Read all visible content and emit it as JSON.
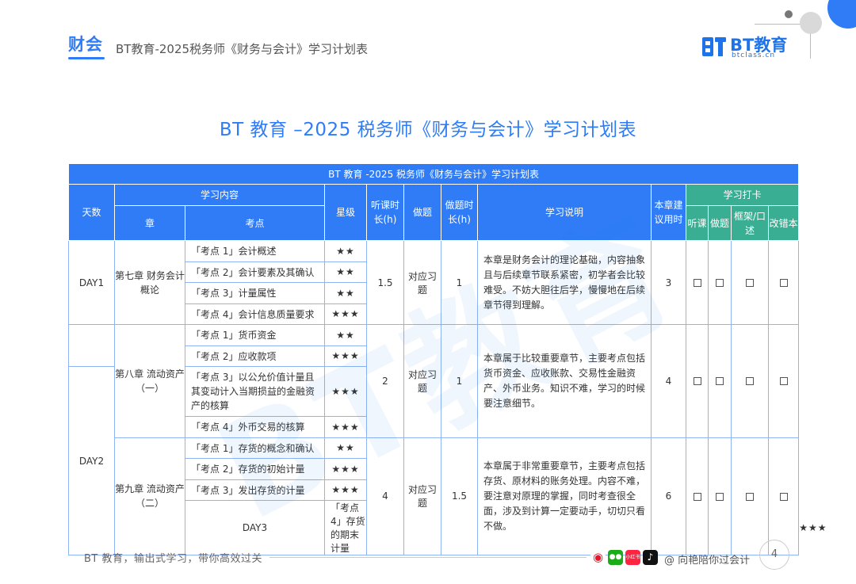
{
  "header": {
    "brand": "财会",
    "title": "BT教育-2025税务师《财务与会计》学习计划表",
    "logo_text": "BT教育",
    "logo_sub": "btclass.cn"
  },
  "main_title": "BT 教育 –2025 税务师《财务与会计》学习计划表",
  "table": {
    "caption": "BT 教育 -2025 税务师《财务与会计》学习计划表",
    "headers": {
      "day": "天数",
      "content": "学习内容",
      "chapter": "章",
      "point": "考点",
      "stars": "星级",
      "listen": "听课时长(h)",
      "exercise": "做题",
      "ex_time": "做题时长(h)",
      "notes": "学习说明",
      "total": "本章建议用时",
      "checkin": "学习打卡",
      "chk_listen": "听课",
      "chk_do": "做题",
      "chk_frame": "框架/口述",
      "chk_fix": "改错本"
    },
    "days": [
      "DAY1",
      "DAY2",
      "DAY3"
    ],
    "chapters": [
      {
        "name": "第七章 财务会计概论",
        "listen": "1.5",
        "exercise": "对应习题",
        "ex_time": "1",
        "note": "本章是财务会计的理论基础，内容抽象且与后续章节联系紧密，初学者会比较难受。不妨大胆往后学，慢慢地在后续章节得到理解。",
        "total": "3",
        "points": [
          {
            "text": "「考点 1」会计概述",
            "stars": "★★"
          },
          {
            "text": "「考点 2」会计要素及其确认",
            "stars": "★★"
          },
          {
            "text": "「考点 3」计量属性",
            "stars": "★★"
          },
          {
            "text": "「考点 4」会计信息质量要求",
            "stars": "★★★"
          }
        ]
      },
      {
        "name": "第八章 流动资产（一）",
        "listen": "2",
        "exercise": "对应习题",
        "ex_time": "1",
        "note": "本章属于比较重要章节，主要考点包括货币资金、应收账款、交易性金融资产、外币业务。知识不难，学习的时候要注意细节。",
        "total": "4",
        "points": [
          {
            "text": "「考点 1」货币资金",
            "stars": "★★"
          },
          {
            "text": "「考点 2」应收款项",
            "stars": "★★★"
          },
          {
            "text": "「考点 3」以公允价值计量且其变动计入当期损益的金融资产的核算",
            "stars": "★★★"
          },
          {
            "text": "「考点 4」外币交易的核算",
            "stars": "★★★"
          }
        ]
      },
      {
        "name": "第九章 流动资产（二）",
        "listen": "4",
        "exercise": "对应习题",
        "ex_time": "1.5",
        "note": "本章属于非常重要章节，主要考点包括存货、原材料的账务处理。内容不难，要注意对原理的掌握，同时考查很全面，涉及到计算一定要动手，切切只看不做。",
        "total": "6",
        "points": [
          {
            "text": "「考点 1」存货的概念和确认",
            "stars": "★★"
          },
          {
            "text": "「考点 2」存货的初始计量",
            "stars": "★★★"
          },
          {
            "text": "「考点 3」发出存货的计量",
            "stars": "★★★"
          },
          {
            "text": "「考点 4」存货的期末计量",
            "stars": "★★★"
          }
        ]
      }
    ]
  },
  "footer": {
    "slogan": "BT 教育，输出式学习，带你高效过关",
    "handle": "@ 向艳陪你过会计",
    "page": "4",
    "social_icons": [
      "weibo-icon",
      "wechat-icon",
      "xiaohongshu-icon",
      "douyin-icon"
    ],
    "xhs_label": "小红书"
  },
  "colors": {
    "primary": "#2f7cf6",
    "checkin": "#3aae92"
  }
}
